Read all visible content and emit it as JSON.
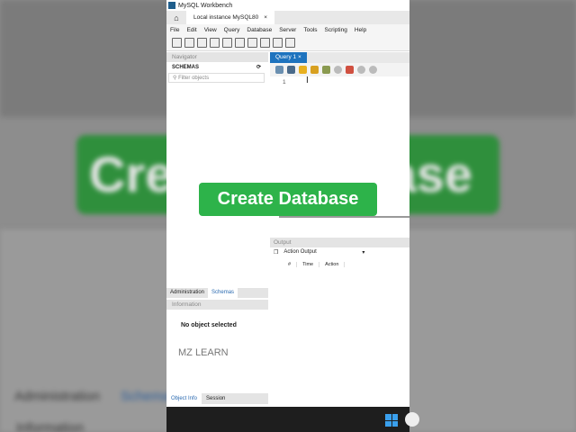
{
  "background": {
    "left_text": "Cre",
    "right_text": "ase",
    "admin": "Administration",
    "schemas": "Schema",
    "info": "Information"
  },
  "window": {
    "title": "MySQL Workbench",
    "connection_tab": "Local instance MySQL80",
    "close": "×"
  },
  "menu": [
    "File",
    "Edit",
    "View",
    "Query",
    "Database",
    "Server",
    "Tools",
    "Scripting",
    "Help"
  ],
  "navigator": {
    "header": "Navigator",
    "schemas": "SCHEMAS",
    "filter_placeholder": "Filter objects",
    "tabs": [
      "Administration",
      "Schemas"
    ],
    "info_header": "Information",
    "no_object": "No object selected",
    "watermark": "MZ LEARN",
    "bottom_tabs": [
      "Object Info",
      "Session"
    ]
  },
  "query": {
    "tab": "Query 1",
    "close": "×",
    "line_number": "1",
    "cursor": "I"
  },
  "output": {
    "header": "Output",
    "selector": "Action Output",
    "columns": [
      "#",
      "Time",
      "Action"
    ]
  },
  "overlay": {
    "title": "Create Database",
    "color": "#2db34a"
  }
}
